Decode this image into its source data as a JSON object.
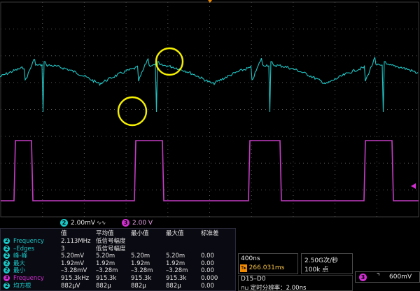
{
  "channels": {
    "ch2": {
      "number": "2",
      "scale": "2.00mV",
      "color": "#19c8c8"
    },
    "ch3": {
      "number": "3",
      "scale": "2.00 V",
      "color": "#d12ed1"
    }
  },
  "measurements": {
    "headers": [
      "值",
      "平均值",
      "最小值",
      "最大值",
      "标准差"
    ],
    "rows": [
      {
        "ch": "2",
        "name": "Frequency",
        "cells": [
          "2.113MHz",
          "低信号幅度",
          "",
          "",
          ""
        ]
      },
      {
        "ch": "2",
        "name": "–Edges",
        "cells": [
          "3",
          "低信号幅度",
          "",
          "",
          ""
        ]
      },
      {
        "ch": "2",
        "name": "峰-峰",
        "cells": [
          "5.20mV",
          "5.20m",
          "5.20m",
          "5.20m",
          "0.00"
        ]
      },
      {
        "ch": "2",
        "name": "最大",
        "cells": [
          "1.92mV",
          "1.92m",
          "1.92m",
          "1.92m",
          "0.00"
        ]
      },
      {
        "ch": "2",
        "name": "最小",
        "cells": [
          "–3.28mV",
          "–3.28m",
          "–3.28m",
          "–3.28m",
          "0.00"
        ]
      },
      {
        "ch": "3",
        "name": "Frequency",
        "cells": [
          "915.3kHz",
          "915.3k",
          "915.3k",
          "915.3k",
          "0.000"
        ]
      },
      {
        "ch": "2",
        "name": "均方根",
        "cells": [
          "882μV",
          "882μ",
          "882μ",
          "882μ",
          "0.00"
        ]
      }
    ]
  },
  "timebase": {
    "scale": "400ns",
    "position": "266.031ms",
    "trigger_icon": "trigger-position-icon"
  },
  "acquisition": {
    "rate": "2.50G次/秒",
    "points": "100k 点"
  },
  "trigger": {
    "source": "3",
    "slope_icon": "falling-edge-icon",
    "level": "600mV"
  },
  "digital": {
    "channels": "D15–D0",
    "sample_label": "定时分辨率：",
    "resolution": "2.00ns"
  }
}
